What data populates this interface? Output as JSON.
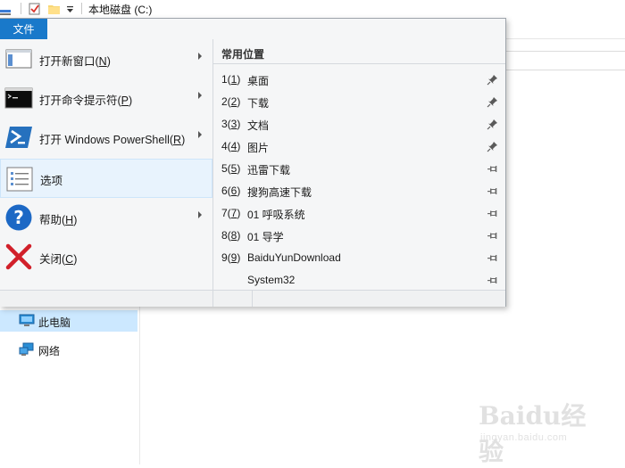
{
  "window": {
    "title": "本地磁盘 (C:)"
  },
  "file_menu": {
    "tab_label": "文件",
    "items": [
      {
        "label_pre": "打开新窗口(",
        "accel": "N",
        "label_post": ")",
        "icon": "new-window-icon",
        "has_submenu": true
      },
      {
        "label_pre": "打开命令提示符(",
        "accel": "P",
        "label_post": ")",
        "icon": "command-prompt-icon",
        "has_submenu": true
      },
      {
        "label_pre": "打开 Windows PowerShell(",
        "accel": "R",
        "label_post": ")",
        "icon": "powershell-icon",
        "has_submenu": true
      },
      {
        "label_pre": "选项",
        "accel": "",
        "label_post": "",
        "icon": "options-icon",
        "has_submenu": false,
        "highlighted": true
      },
      {
        "label_pre": "帮助(",
        "accel": "H",
        "label_post": ")",
        "icon": "help-icon",
        "has_submenu": true
      },
      {
        "label_pre": "关闭(",
        "accel": "C",
        "label_post": ")",
        "icon": "close-icon",
        "has_submenu": false
      }
    ],
    "frequent_places": {
      "title": "常用位置",
      "items": [
        {
          "num_pre": "1(",
          "num_accel": "1",
          "num_post": ")",
          "label": "桌面",
          "pinned": true
        },
        {
          "num_pre": "2(",
          "num_accel": "2",
          "num_post": ")",
          "label": "下载",
          "pinned": true
        },
        {
          "num_pre": "3(",
          "num_accel": "3",
          "num_post": ")",
          "label": "文档",
          "pinned": true
        },
        {
          "num_pre": "4(",
          "num_accel": "4",
          "num_post": ")",
          "label": "图片",
          "pinned": true
        },
        {
          "num_pre": "5(",
          "num_accel": "5",
          "num_post": ")",
          "label": "迅雷下载",
          "pinned": false
        },
        {
          "num_pre": "6(",
          "num_accel": "6",
          "num_post": ")",
          "label": "搜狗高速下载",
          "pinned": false
        },
        {
          "num_pre": "7(",
          "num_accel": "7",
          "num_post": ")",
          "label": "01 呼吸系统",
          "pinned": false
        },
        {
          "num_pre": "8(",
          "num_accel": "8",
          "num_post": ")",
          "label": "01 导学",
          "pinned": false
        },
        {
          "num_pre": "9(",
          "num_accel": "9",
          "num_post": ")",
          "label": "BaiduYunDownload",
          "pinned": false
        },
        {
          "num_pre": "",
          "num_accel": "",
          "num_post": "",
          "label": "System32",
          "pinned": false
        }
      ]
    }
  },
  "nav_pane": {
    "items": [
      {
        "label": "此电脑",
        "icon": "this-pc-icon",
        "selected": true
      },
      {
        "label": "网络",
        "icon": "network-icon",
        "selected": false
      }
    ]
  },
  "watermark": {
    "brand": "Baidu经验",
    "url": "jingyan.baidu.com"
  },
  "colors": {
    "accent": "#1979ca",
    "menu_bg": "#f5f6f7",
    "hover_bg": "#e8f3fd",
    "selected_bg": "#cce8ff"
  }
}
